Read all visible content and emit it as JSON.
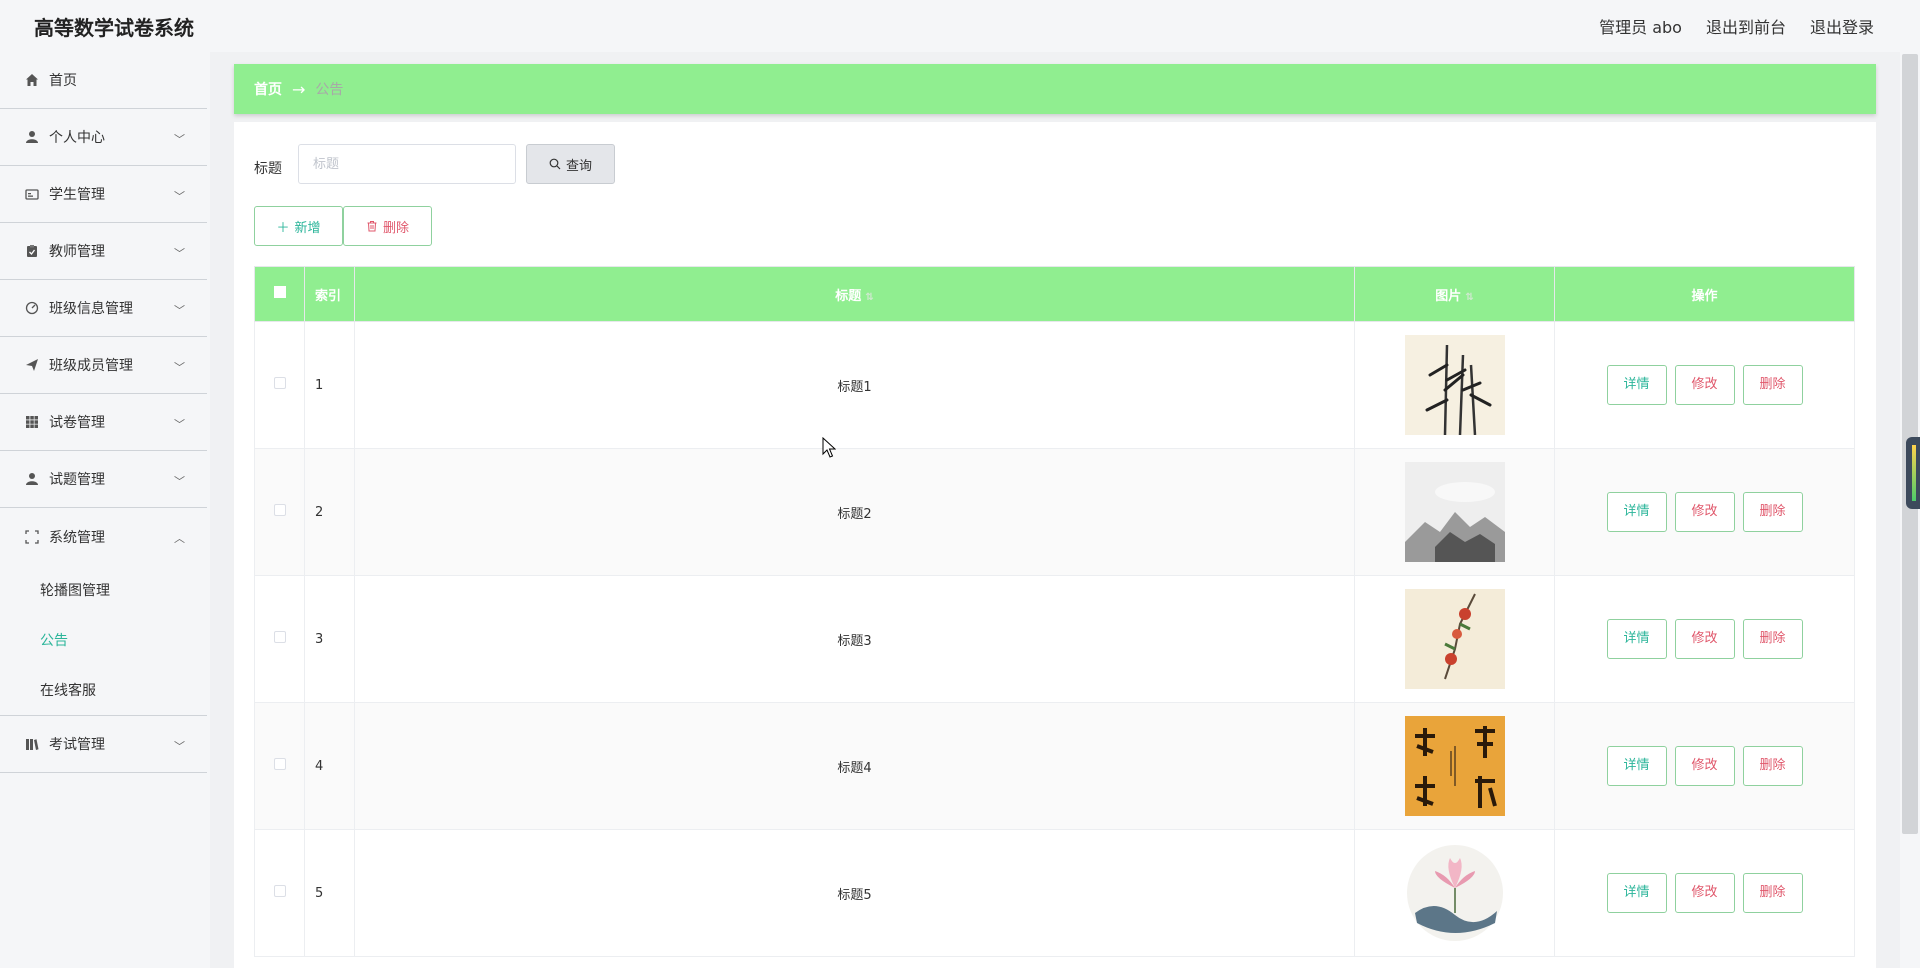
{
  "app": {
    "title": "高等数学试卷系统"
  },
  "topnav": {
    "user": "管理员 abo",
    "front": "退出到前台",
    "logout": "退出登录"
  },
  "sidebar": {
    "items": [
      {
        "label": "首页",
        "icon": "home-icon"
      },
      {
        "label": "个人中心",
        "icon": "user-icon"
      },
      {
        "label": "学生管理",
        "icon": "id-card-icon"
      },
      {
        "label": "教师管理",
        "icon": "clipboard-icon"
      },
      {
        "label": "班级信息管理",
        "icon": "gauge-icon"
      },
      {
        "label": "班级成员管理",
        "icon": "paper-plane-icon"
      },
      {
        "label": "试卷管理",
        "icon": "grid-icon"
      },
      {
        "label": "试题管理",
        "icon": "user-icon"
      },
      {
        "label": "系统管理",
        "icon": "fullscreen-icon"
      },
      {
        "label": "考试管理",
        "icon": "books-icon"
      }
    ],
    "sub_items": [
      "轮播图管理",
      "公告",
      "在线客服"
    ],
    "active": "公告"
  },
  "breadcrumb": {
    "home": "首页",
    "arrow": "→",
    "current": "公告"
  },
  "search": {
    "label": "标题",
    "placeholder": "标题",
    "button": "查询"
  },
  "actions": {
    "add": "新增",
    "delete": "删除"
  },
  "table": {
    "headers": {
      "index": "索引",
      "title": "标题",
      "image": "图片",
      "ops": "操作"
    },
    "rows": [
      {
        "index": "1",
        "title": "标题1",
        "image": "bamboo-ink-painting"
      },
      {
        "index": "2",
        "title": "标题2",
        "image": "misty-mountain-ink-painting"
      },
      {
        "index": "3",
        "title": "标题3",
        "image": "red-flower-branch-painting"
      },
      {
        "index": "4",
        "title": "标题4",
        "image": "calligraphy-on-gold"
      },
      {
        "index": "5",
        "title": "标题5",
        "image": "lotus-round-painting"
      }
    ],
    "ops": {
      "detail": "详情",
      "edit": "修改",
      "delete": "删除"
    }
  },
  "colors": {
    "accent_green": "#90ee90",
    "teal_text": "#2bb59a",
    "red_text": "#e0576b",
    "background": "#f5f6f8"
  }
}
